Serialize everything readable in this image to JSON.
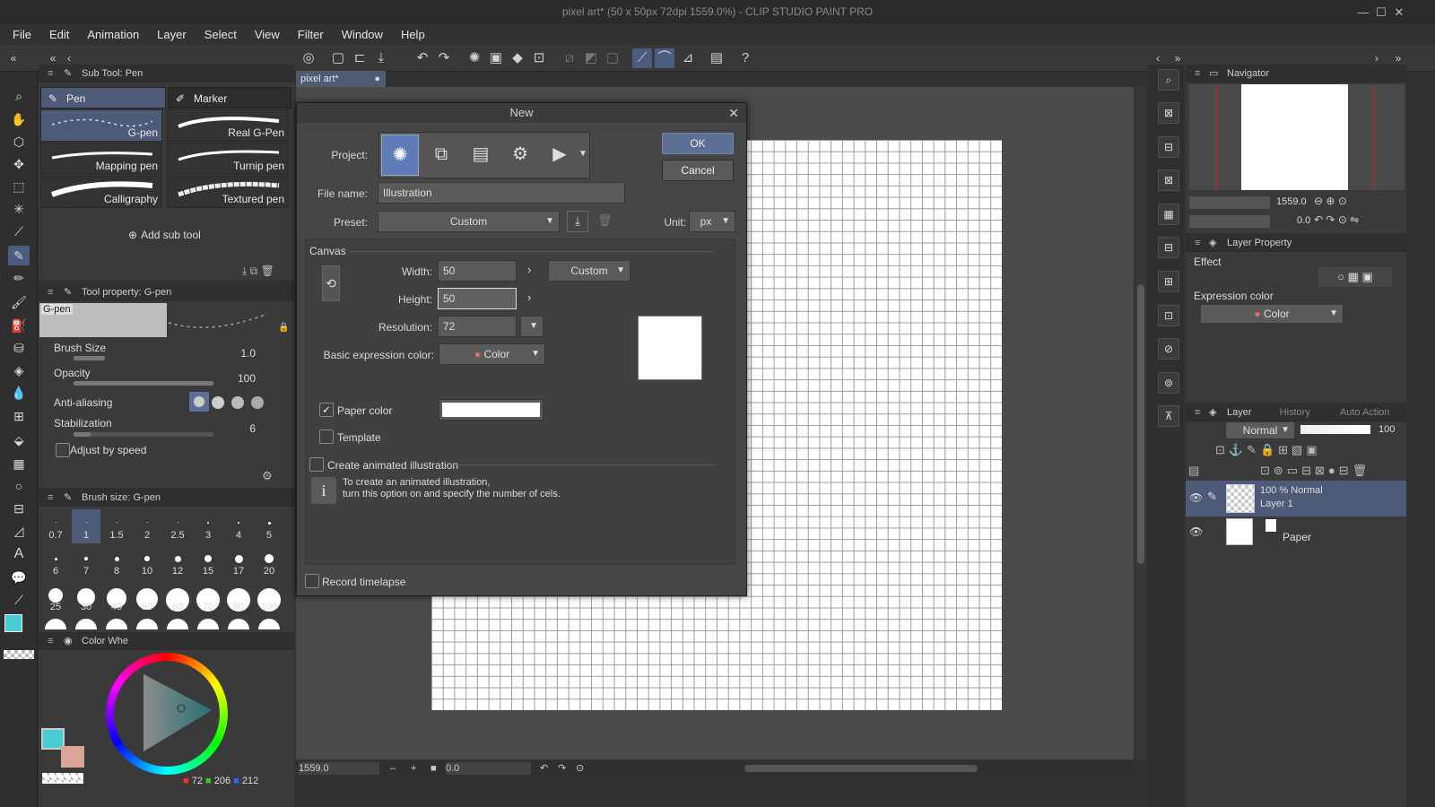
{
  "window": {
    "title": "pixel art* (50 x 50px 72dpi 1559.0%) - CLIP STUDIO PAINT PRO",
    "minimize": "—",
    "maximize": "☐",
    "close": "✕"
  },
  "menu": [
    "File",
    "Edit",
    "Animation",
    "Layer",
    "Select",
    "View",
    "Filter",
    "Window",
    "Help"
  ],
  "subtool_panel": {
    "title": "Sub Tool: Pen",
    "groups": [
      "Pen",
      "Marker"
    ],
    "items": [
      "G-pen",
      "Real G-Pen",
      "Mapping pen",
      "Turnip pen",
      "Calligraphy",
      "Textured pen"
    ],
    "add_label": "Add sub tool"
  },
  "tool_property": {
    "title": "Tool property: G-pen",
    "preview_label": "G-pen",
    "brush_size_label": "Brush Size",
    "brush_size_value": "1.0",
    "opacity_label": "Opacity",
    "opacity_value": "100",
    "antialias_label": "Anti-aliasing",
    "stabilization_label": "Stabilization",
    "stabilization_value": "6",
    "adjust_label": "Adjust by speed"
  },
  "brush_size_panel": {
    "title": "Brush size: G-pen",
    "sizes": [
      "0.7",
      "1",
      "1.5",
      "2",
      "2.5",
      "3",
      "4",
      "5",
      "6",
      "7",
      "8",
      "10",
      "12",
      "15",
      "17",
      "20",
      "25",
      "30",
      "40",
      "50",
      "60",
      "70",
      "80",
      "100"
    ]
  },
  "color_panel": {
    "title": "Color Whe",
    "r": "72",
    "g": "206",
    "b": "212"
  },
  "colors": {
    "main": "#48ced4",
    "sub": "#d9a596",
    "accent": "#5d6f92",
    "selection": "#4d5a78"
  },
  "document": {
    "tab": "pixel art*",
    "zoom": "1559.0",
    "rotation": "0.0"
  },
  "dialog": {
    "title": "New",
    "project_label": "Project:",
    "file_name_label": "File name:",
    "file_name_value": "Illustration",
    "preset_label": "Preset:",
    "preset_value": "Custom",
    "unit_label": "Unit:",
    "unit_value": "px",
    "canvas_label": "Canvas",
    "width_label": "Width:",
    "width_value": "50",
    "height_label": "Height:",
    "height_value": "50",
    "size_preset": "Custom",
    "resolution_label": "Resolution:",
    "resolution_value": "72",
    "expr_label": "Basic expression color:",
    "expr_value": "Color",
    "paper_color_label": "Paper color",
    "template_label": "Template",
    "animated_label": "Create animated illustration",
    "info_text_1": "To create an animated illustration,",
    "info_text_2": "turn this option on and specify the number of cels.",
    "timelapse_label": "Record timelapse",
    "ok": "OK",
    "cancel": "Cancel"
  },
  "navigator": {
    "title": "Navigator",
    "zoom": "1559.0",
    "rotation": "0.0"
  },
  "layer_property": {
    "title": "Layer Property",
    "effect_label": "Effect",
    "expr_label": "Expression color",
    "expr_value": "Color"
  },
  "layer_panel": {
    "tabs": [
      "Layer",
      "History",
      "Auto Action"
    ],
    "blend": "Normal",
    "opacity": "100",
    "layers": [
      {
        "mode": "100 % Normal",
        "name": "Layer 1"
      },
      {
        "name": "Paper"
      }
    ]
  }
}
